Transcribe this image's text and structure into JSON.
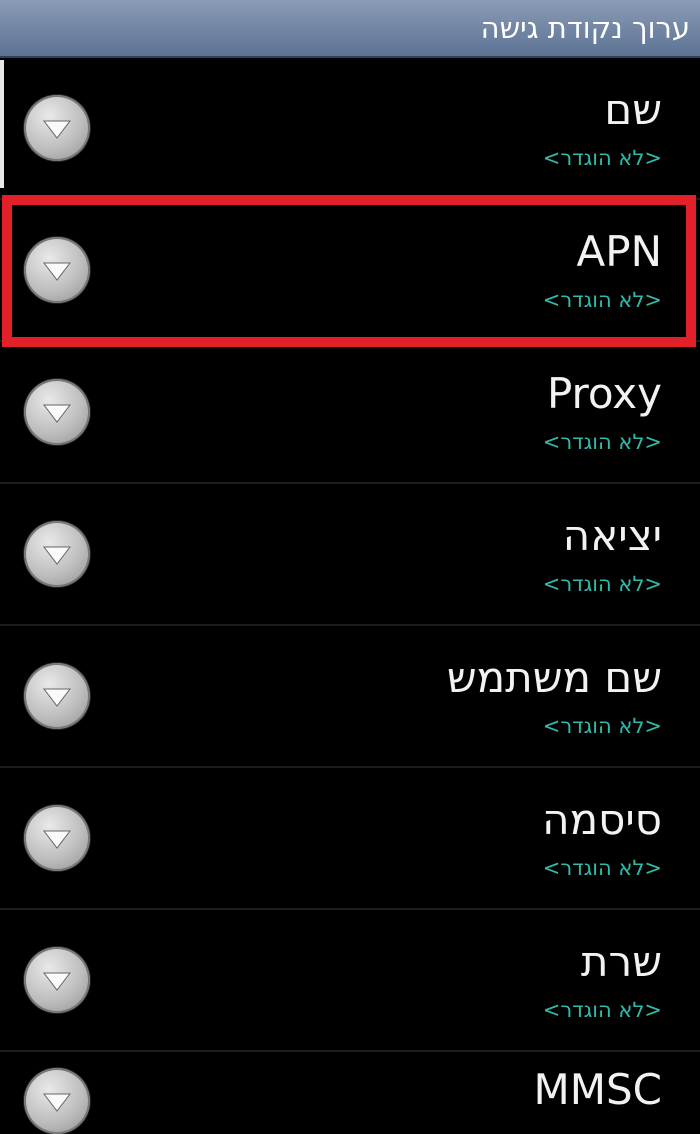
{
  "title": "ערוך נקודת גישה",
  "items": [
    {
      "label": "שם",
      "value": "<לא הוגדר>"
    },
    {
      "label": "APN",
      "value": "<לא הוגדר>"
    },
    {
      "label": "Proxy",
      "value": "<לא הוגדר>"
    },
    {
      "label": "יציאה",
      "value": "<לא הוגדר>"
    },
    {
      "label": "שם משתמש",
      "value": "<לא הוגדר>"
    },
    {
      "label": "סיסמה",
      "value": "<לא הוגדר>"
    },
    {
      "label": "שרת",
      "value": "<לא הוגדר>"
    },
    {
      "label": "MMSC"
    }
  ],
  "colors": {
    "highlight": "#e3202a",
    "value_text": "#31b9a9",
    "title_bar": "#6f84a4"
  },
  "icons": {
    "row_icon": "dropdown-arrow-icon"
  }
}
